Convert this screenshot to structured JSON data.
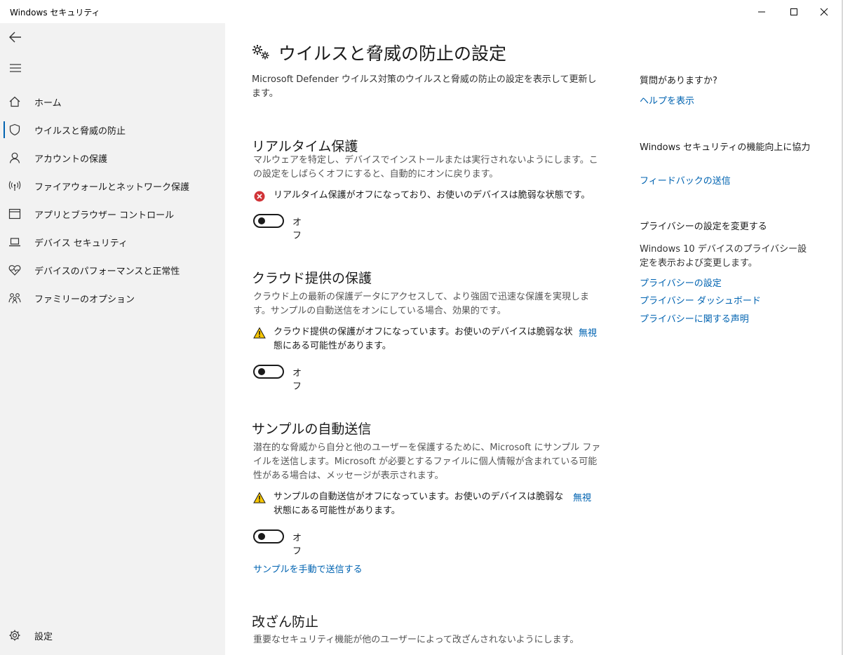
{
  "window": {
    "title": "Windows セキュリティ"
  },
  "sidebar": {
    "items": [
      {
        "label": "ホーム",
        "icon": "home-icon"
      },
      {
        "label": "ウイルスと脅威の防止",
        "icon": "shield-icon",
        "active": true
      },
      {
        "label": "アカウントの保護",
        "icon": "person-icon"
      },
      {
        "label": "ファイアウォールとネットワーク保護",
        "icon": "wifi-antenna-icon"
      },
      {
        "label": "アプリとブラウザー コントロール",
        "icon": "app-window-icon"
      },
      {
        "label": "デバイス セキュリティ",
        "icon": "laptop-icon"
      },
      {
        "label": "デバイスのパフォーマンスと正常性",
        "icon": "heart-pulse-icon"
      },
      {
        "label": "ファミリーのオプション",
        "icon": "family-icon"
      }
    ],
    "settings_label": "設定"
  },
  "main": {
    "title": "ウイルスと脅威の防止の設定",
    "description": "Microsoft Defender ウイルス対策のウイルスと脅威の防止の設定を表示して更新します。",
    "realtime": {
      "title": "リアルタイム保護",
      "description": "マルウェアを特定し、デバイスでインストールまたは実行されないようにします。この設定をしばらくオフにすると、自動的にオンに戻ります。",
      "alert": "リアルタイム保護がオフになっており、お使いのデバイスは脆弱な状態です。",
      "toggle_label": "オフ"
    },
    "cloud": {
      "title": "クラウド提供の保護",
      "description": "クラウド上の最新の保護データにアクセスして、より強固で迅速な保護を実現します。サンプルの自動送信をオンにしている場合、効果的です。",
      "alert": "クラウド提供の保護がオフになっています。お使いのデバイスは脆弱な状態にある可能性があります。",
      "dismiss": "無視",
      "toggle_label": "オフ"
    },
    "sample": {
      "title": "サンプルの自動送信",
      "description": "潜在的な脅威から自分と他のユーザーを保護するために、Microsoft にサンプル ファイルを送信します。Microsoft が必要とするファイルに個人情報が含まれている可能性がある場合は、メッセージが表示されます。",
      "alert": "サンプルの自動送信がオフになっています。お使いのデバイスは脆弱な状態にある可能性があります。",
      "dismiss": "無視",
      "toggle_label": "オフ",
      "manual_link": "サンプルを手動で送信する"
    },
    "tamper": {
      "title": "改ざん防止",
      "description": "重要なセキュリティ機能が他のユーザーによって改ざんされないようにします。"
    }
  },
  "aside": {
    "question": "質問がありますか?",
    "help_link": "ヘルプを表示",
    "improve": "Windows セキュリティの機能向上に協力",
    "feedback_link": "フィードバックの送信",
    "privacy_heading": "プライバシーの設定を変更する",
    "privacy_desc": "Windows 10 デバイスのプライバシー設定を表示および変更します。",
    "privacy_settings_link": "プライバシーの設定",
    "privacy_dashboard_link": "プライバシー ダッシュボード",
    "privacy_statement_link": "プライバシーに関する声明"
  },
  "colors": {
    "accent": "#0063b1",
    "error": "#d13438",
    "warning": "#f7c600",
    "sidebar_bg": "#f2f2f2"
  }
}
